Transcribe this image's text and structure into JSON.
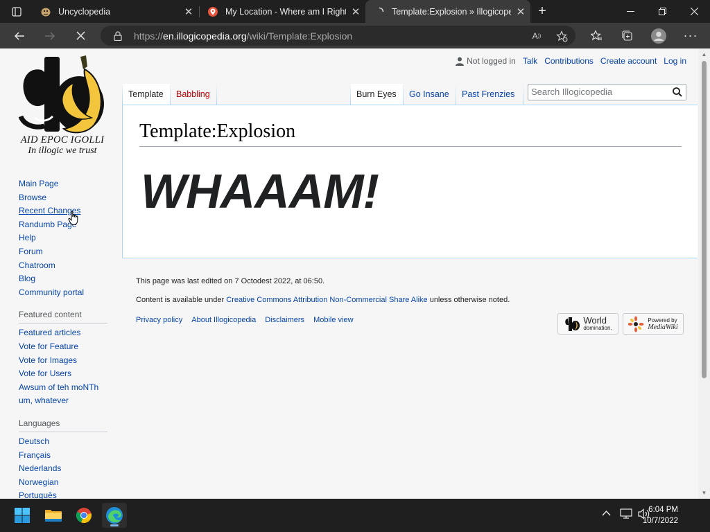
{
  "browser": {
    "tabs": [
      {
        "title": "Uncyclopedia",
        "icon": "potato-icon",
        "active": false
      },
      {
        "title": "My Location - Where am I Right",
        "icon": "map-pin-icon",
        "active": false
      },
      {
        "title": "Template:Explosion » Illogicopedia",
        "icon": "loading-icon",
        "active": true
      }
    ],
    "new_tab_symbol": "+",
    "close_symbol": "✕",
    "url_prefix": "https://",
    "url_host": "en.illogicopedia.org",
    "url_path": "/wiki/Template:Explosion",
    "accent": "#0078d4"
  },
  "page": {
    "logo_line1": "AID EPOC IGOLLI",
    "logo_line2": "In illogic we trust",
    "personal": {
      "user": "Not logged in",
      "links": [
        "Talk",
        "Contributions",
        "Create account",
        "Log in"
      ]
    },
    "tabs_left": [
      {
        "label": "Template",
        "selected": true,
        "new": false
      },
      {
        "label": "Babbling",
        "selected": false,
        "new": true
      }
    ],
    "tabs_right": [
      {
        "label": "Burn Eyes",
        "selected": true
      },
      {
        "label": "Go Insane",
        "selected": false
      },
      {
        "label": "Past Frenzies",
        "selected": false
      }
    ],
    "search_placeholder": "Search Illogicopedia",
    "heading": "Template:Explosion",
    "body_text": "WHAAAM!",
    "navigation": [
      "Main Page",
      "Browse",
      "Recent Changes",
      "Randumb Page",
      "Help",
      "Forum",
      "Chatroom",
      "Blog",
      "Community portal"
    ],
    "featured_head": "Featured content",
    "featured": [
      "Featured articles",
      "Vote for Feature",
      "Vote for Images",
      "Vote for Users",
      "Awsum of teh moNTh",
      "um, whatever"
    ],
    "languages_head": "Languages",
    "languages": [
      "Deutsch",
      "Français",
      "Nederlands",
      "Norwegian",
      "Português"
    ],
    "footer": {
      "last_edited": "This page was last edited on 7 Octodest 2022, at 06:50.",
      "license_prefix": "Content is available under ",
      "license_link": "Creative Commons Attribution Non-Commercial Share Alike",
      "license_suffix": " unless otherwise noted.",
      "places": [
        "Privacy policy",
        "About Illogicopedia",
        "Disclaimers",
        "Mobile view"
      ],
      "badge1_top": "World",
      "badge1_bottom": "domination.",
      "badge2_top": "Powered by",
      "badge2_bottom": "MediaWiki"
    }
  },
  "taskbar": {
    "time": "6:04 PM",
    "date": "10/7/2022",
    "apps": [
      "windows-start-icon",
      "file-explorer-icon",
      "chrome-icon",
      "edge-icon"
    ]
  }
}
